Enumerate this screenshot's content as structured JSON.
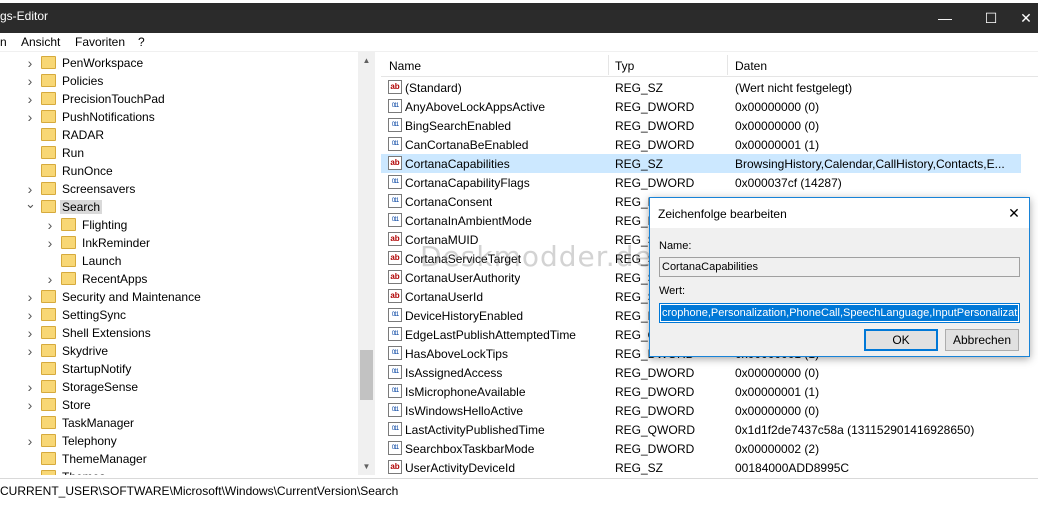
{
  "window": {
    "title": "gs-Editor",
    "minimize_glyph": "—",
    "maximize_glyph": "☐",
    "close_glyph": "✕"
  },
  "menu": [
    "n",
    "Ansicht",
    "Favoriten",
    "?"
  ],
  "tree": {
    "items": [
      {
        "label": "PenWorkspace",
        "level": 0,
        "expander": "right"
      },
      {
        "label": "Policies",
        "level": 0,
        "expander": "right"
      },
      {
        "label": "PrecisionTouchPad",
        "level": 0,
        "expander": "right"
      },
      {
        "label": "PushNotifications",
        "level": 0,
        "expander": "right"
      },
      {
        "label": "RADAR",
        "level": 0,
        "expander": "none"
      },
      {
        "label": "Run",
        "level": 0,
        "expander": "none"
      },
      {
        "label": "RunOnce",
        "level": 0,
        "expander": "none"
      },
      {
        "label": "Screensavers",
        "level": 0,
        "expander": "right"
      },
      {
        "label": "Search",
        "level": 0,
        "expander": "down",
        "selected": true
      },
      {
        "label": "Flighting",
        "level": 1,
        "expander": "right"
      },
      {
        "label": "InkReminder",
        "level": 1,
        "expander": "right"
      },
      {
        "label": "Launch",
        "level": 1,
        "expander": "none"
      },
      {
        "label": "RecentApps",
        "level": 1,
        "expander": "right"
      },
      {
        "label": "Security and Maintenance",
        "level": 0,
        "expander": "right"
      },
      {
        "label": "SettingSync",
        "level": 0,
        "expander": "right"
      },
      {
        "label": "Shell Extensions",
        "level": 0,
        "expander": "right"
      },
      {
        "label": "Skydrive",
        "level": 0,
        "expander": "right"
      },
      {
        "label": "StartupNotify",
        "level": 0,
        "expander": "none"
      },
      {
        "label": "StorageSense",
        "level": 0,
        "expander": "right"
      },
      {
        "label": "Store",
        "level": 0,
        "expander": "right"
      },
      {
        "label": "TaskManager",
        "level": 0,
        "expander": "none"
      },
      {
        "label": "Telephony",
        "level": 0,
        "expander": "right"
      },
      {
        "label": "ThemeManager",
        "level": 0,
        "expander": "none"
      },
      {
        "label": "Themes",
        "level": 0,
        "expander": "right"
      }
    ]
  },
  "list": {
    "columns": [
      "Name",
      "Typ",
      "Daten"
    ],
    "rows": [
      {
        "name": "(Standard)",
        "type": "REG_SZ",
        "data": "(Wert nicht festgelegt)",
        "icon": "sz"
      },
      {
        "name": "AnyAboveLockAppsActive",
        "type": "REG_DWORD",
        "data": "0x00000000 (0)",
        "icon": "dw"
      },
      {
        "name": "BingSearchEnabled",
        "type": "REG_DWORD",
        "data": "0x00000000 (0)",
        "icon": "dw"
      },
      {
        "name": "CanCortanaBeEnabled",
        "type": "REG_DWORD",
        "data": "0x00000001 (1)",
        "icon": "dw"
      },
      {
        "name": "CortanaCapabilities",
        "type": "REG_SZ",
        "data": "BrowsingHistory,Calendar,CallHistory,Contacts,E...",
        "icon": "sz",
        "selected": true
      },
      {
        "name": "CortanaCapabilityFlags",
        "type": "REG_DWORD",
        "data": "0x000037cf (14287)",
        "icon": "dw"
      },
      {
        "name": "CortanaConsent",
        "type": "REG_D",
        "data": "",
        "icon": "dw"
      },
      {
        "name": "CortanaInAmbientMode",
        "type": "REG_D",
        "data": "",
        "icon": "dw"
      },
      {
        "name": "CortanaMUID",
        "type": "REG_S",
        "data": "",
        "icon": "sz"
      },
      {
        "name": "CortanaServiceTarget",
        "type": "REG_S",
        "data": "",
        "icon": "sz"
      },
      {
        "name": "CortanaUserAuthority",
        "type": "REG_S",
        "data": "",
        "icon": "sz"
      },
      {
        "name": "CortanaUserId",
        "type": "REG_S",
        "data": "",
        "icon": "sz"
      },
      {
        "name": "DeviceHistoryEnabled",
        "type": "REG_D",
        "data": "",
        "icon": "dw"
      },
      {
        "name": "EdgeLastPublishAttemptedTime",
        "type": "REG_Q",
        "data": "",
        "icon": "dw"
      },
      {
        "name": "HasAboveLockTips",
        "type": "REG_DWORD",
        "data": "0x00000001 (1)",
        "icon": "dw"
      },
      {
        "name": "IsAssignedAccess",
        "type": "REG_DWORD",
        "data": "0x00000000 (0)",
        "icon": "dw"
      },
      {
        "name": "IsMicrophoneAvailable",
        "type": "REG_DWORD",
        "data": "0x00000001 (1)",
        "icon": "dw"
      },
      {
        "name": "IsWindowsHelloActive",
        "type": "REG_DWORD",
        "data": "0x00000000 (0)",
        "icon": "dw"
      },
      {
        "name": "LastActivityPublishedTime",
        "type": "REG_QWORD",
        "data": "0x1d1f2de7437c58a (131152901416928650)",
        "icon": "dw"
      },
      {
        "name": "SearchboxTaskbarMode",
        "type": "REG_DWORD",
        "data": "0x00000002 (2)",
        "icon": "dw"
      },
      {
        "name": "UserActivityDeviceId",
        "type": "REG_SZ",
        "data": "00184000ADD8995C",
        "icon": "sz"
      }
    ]
  },
  "statusbar": {
    "path": "CURRENT_USER\\SOFTWARE\\Microsoft\\Windows\\CurrentVersion\\Search"
  },
  "watermark": "Deskmodder.de",
  "dialog": {
    "title": "Zeichenfolge bearbeiten",
    "name_label": "Name:",
    "name_value": "CortanaCapabilities",
    "value_label": "Wert:",
    "value_value": "crophone,Personalization,PhoneCall,SpeechLanguage,InputPersonalization",
    "ok_label": "OK",
    "cancel_label": "Abbrechen",
    "close_glyph": "✕"
  }
}
